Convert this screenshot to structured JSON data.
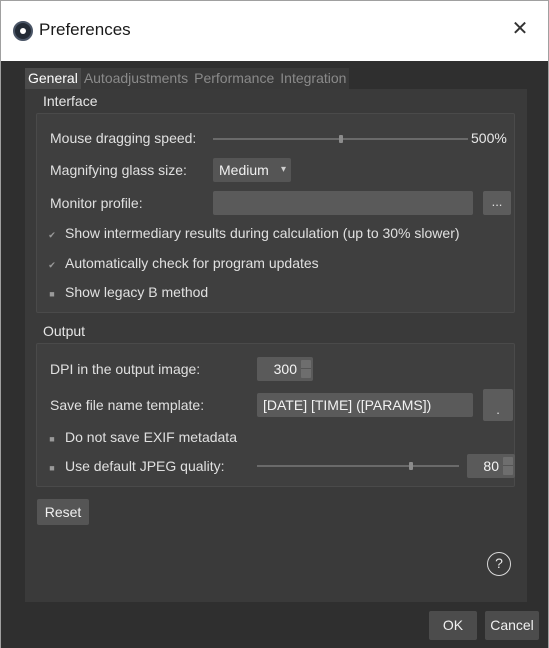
{
  "window": {
    "title": "Preferences",
    "close_glyph": "✕"
  },
  "tabs": [
    {
      "label": "General"
    },
    {
      "label": "Autoadjustments"
    },
    {
      "label": "Performance"
    },
    {
      "label": "Integration"
    }
  ],
  "interface": {
    "group_title": "Interface",
    "mouse_speed": {
      "label": "Mouse dragging speed:",
      "value_text": "500%",
      "slider_fraction": 0.5
    },
    "magnifier": {
      "label": "Magnifying glass size:",
      "selected": "Medium",
      "arrow": "▾"
    },
    "monitor_profile": {
      "label": "Monitor profile:",
      "value": "",
      "browse_label": "..."
    },
    "checks": [
      {
        "label": "Show intermediary results during calculation (up to 30% slower)",
        "checked": true
      },
      {
        "label": "Automatically check for program updates",
        "checked": true
      },
      {
        "label": "Show legacy B method",
        "checked": false
      }
    ]
  },
  "output": {
    "group_title": "Output",
    "dpi": {
      "label": "DPI in the output image:",
      "value": "300"
    },
    "template": {
      "label": "Save file name template:",
      "value": "[DATE] [TIME] ([PARAMS])",
      "button_glyph": "."
    },
    "checks": [
      {
        "label": "Do not save EXIF metadata",
        "checked": false
      },
      {
        "label": "Use default JPEG quality:",
        "checked": false
      }
    ],
    "jpeg_quality": {
      "value": "80",
      "slider_fraction": 0.76
    }
  },
  "buttons": {
    "reset": "Reset",
    "ok": "OK",
    "cancel": "Cancel",
    "help": "?"
  },
  "glyphs": {
    "checked": "✔",
    "unchecked": "■"
  }
}
